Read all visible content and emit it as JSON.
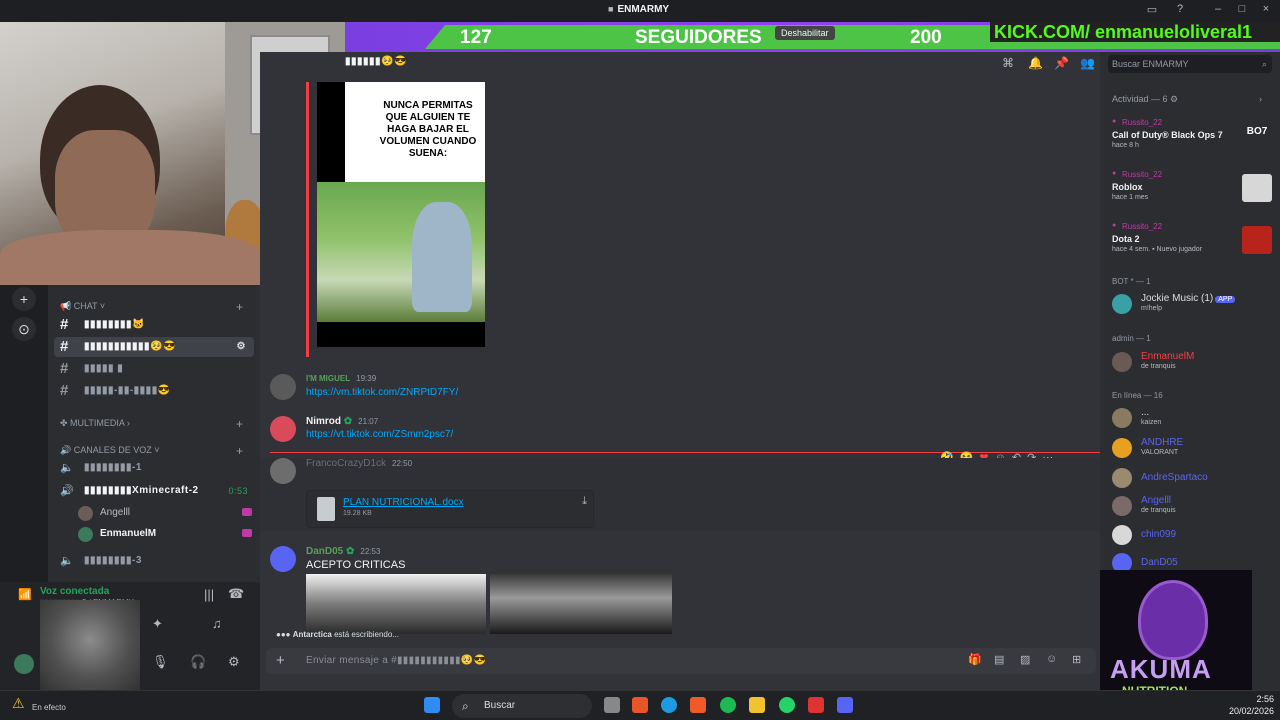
{
  "window": {
    "title": "ENMARMY"
  },
  "overlay": {
    "followers_count": "127",
    "followers_label": "SEGUIDORES",
    "disable_label": "Deshabilitar",
    "goal": "200",
    "kick": "KICK.COM/ enmanueloliveral1"
  },
  "header": {
    "channel_name": "▮▮▮▮▮▮🥺😎",
    "search_placeholder": "Buscar ENMARMY"
  },
  "meme": {
    "caption": "NUNCA PERMITAS QUE ALGUIEN TE HAGA BAJAR EL VOLUMEN CUANDO SUENA:"
  },
  "channels": {
    "cat_chat": "CHAT",
    "cat_multimedia": "MULTIMEDIA",
    "cat_voice": "CANALES DE VOZ",
    "text": [
      "▮▮▮▮▮▮▮▮🐱",
      "▮▮▮▮▮▮▮▮▮▮▮🥺😎",
      "▮▮▮▮▮ ▮",
      "▮▮▮▮▮-▮▮-▮▮▮▮😎"
    ],
    "voice": [
      "▮▮▮▮▮▮▮▮-1",
      "▮▮▮▮▮▮▮▮Xminecraft-2",
      "▮▮▮▮▮▮▮▮-3"
    ],
    "voice_time": "0:53",
    "voice_users": [
      "Angelll",
      "EnmanuelM"
    ]
  },
  "user_panel": {
    "voice_status": "Voz conectada",
    "voice_sub": "▮▮▮▮▮▮▮▮▮ 2 / ENMARMY"
  },
  "messages": [
    {
      "author": "I'M MIGUEL",
      "time": "19:39",
      "link": "https://vm.tiktok.com/ZNRPtD7FY/"
    },
    {
      "author": "Nimrod",
      "time": "21:07",
      "link": "https://vt.tiktok.com/ZSmm2psc7/"
    },
    {
      "author": "FrancoCrazyD1ck",
      "time": "22:50",
      "file_name": "PLAN NUTRICIONAL.docx",
      "file_size": "19.28 KB"
    },
    {
      "author": "DanD05",
      "time": "22:53",
      "text": "ACEPTO CRITICAS"
    }
  ],
  "typing": {
    "user": "Antarctica",
    "suffix": " está escribiendo..."
  },
  "composer": {
    "placeholder": "Enviar mensaje a #▮▮▮▮▮▮▮▮▮▮▮🥺😎"
  },
  "activity": {
    "label": "Actividad — 6",
    "items": [
      {
        "user": "Russito_22",
        "game": "Call of Duty® Black Ops 7",
        "time": "hace 8 h"
      },
      {
        "user": "Russito_22",
        "game": "Roblox",
        "time": "hace 1 mes"
      },
      {
        "user": "Russito_22",
        "game": "Dota 2",
        "time": "hace 4 sem. ▪ Nuevo jugador"
      }
    ]
  },
  "member_sections": {
    "bot": "BOT * — 1",
    "admin": "admin — 1",
    "online": "En línea — 16"
  },
  "members": [
    {
      "name": "Jockie Music (1)",
      "status": "m!help",
      "badge": "APP"
    },
    {
      "name": "EnmanuelM",
      "status": "de tranquis"
    },
    {
      "name": "...",
      "status": "kaizen"
    },
    {
      "name": "ANDHRE",
      "status": "VALORANT"
    },
    {
      "name": "AndreSpartaco",
      "status": ""
    },
    {
      "name": "Angelll",
      "status": "de tranquis"
    },
    {
      "name": "chin099",
      "status": ""
    },
    {
      "name": "DanD05",
      "status": ""
    }
  ],
  "logo": {
    "brand": "AKUMA",
    "sub": "NUTRITION"
  },
  "taskbar": {
    "search": "Buscar",
    "weather": "En efecto",
    "time": "2:56",
    "date": "20/02/2026"
  }
}
